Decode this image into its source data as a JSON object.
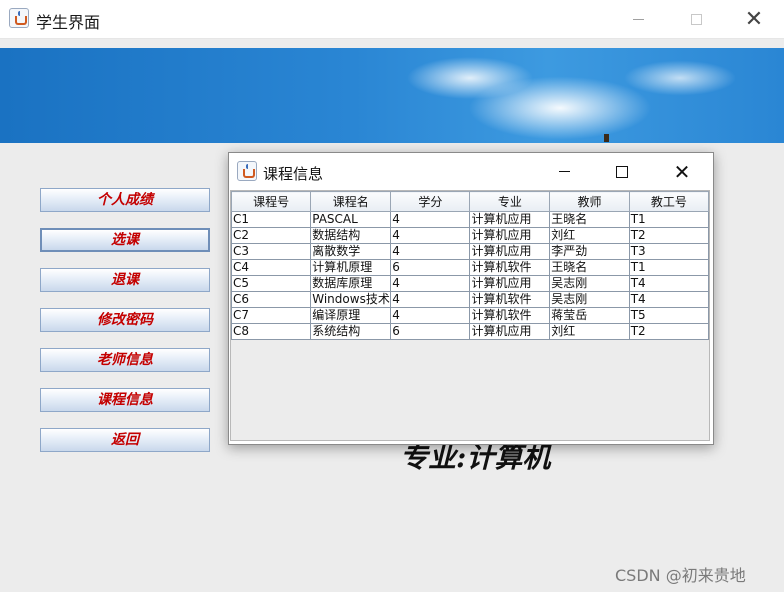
{
  "window": {
    "title": "学生界面"
  },
  "sidebar": {
    "buttons": [
      {
        "label": "个人成绩"
      },
      {
        "label": "选课"
      },
      {
        "label": "退课"
      },
      {
        "label": "修改密码"
      },
      {
        "label": "老师信息"
      },
      {
        "label": "课程信息"
      },
      {
        "label": "返回"
      }
    ]
  },
  "main": {
    "major_label": "专业:计算机"
  },
  "dialog": {
    "title": "课程信息",
    "table": {
      "headers": [
        "课程号",
        "课程名",
        "学分",
        "专业",
        "教师",
        "教工号"
      ],
      "rows": [
        [
          "C1",
          "PASCAL",
          "4",
          "计算机应用",
          "王晓名",
          "T1"
        ],
        [
          "C2",
          "数据结构",
          "4",
          "计算机应用",
          "刘红",
          "T2"
        ],
        [
          "C3",
          "离散数学",
          "4",
          "计算机应用",
          "李严劲",
          "T3"
        ],
        [
          "C4",
          "计算机原理",
          "6",
          "计算机软件",
          "王晓名",
          "T1"
        ],
        [
          "C5",
          "数据库原理",
          "4",
          "计算机应用",
          "吴志刚",
          "T4"
        ],
        [
          "C6",
          "Windows技术",
          "4",
          "计算机软件",
          "吴志刚",
          "T4"
        ],
        [
          "C7",
          "编译原理",
          "4",
          "计算机软件",
          "蒋莹岳",
          "T5"
        ],
        [
          "C8",
          "系统结构",
          "6",
          "计算机应用",
          "刘红",
          "T2"
        ]
      ]
    }
  },
  "watermark": "CSDN @初来贵地"
}
